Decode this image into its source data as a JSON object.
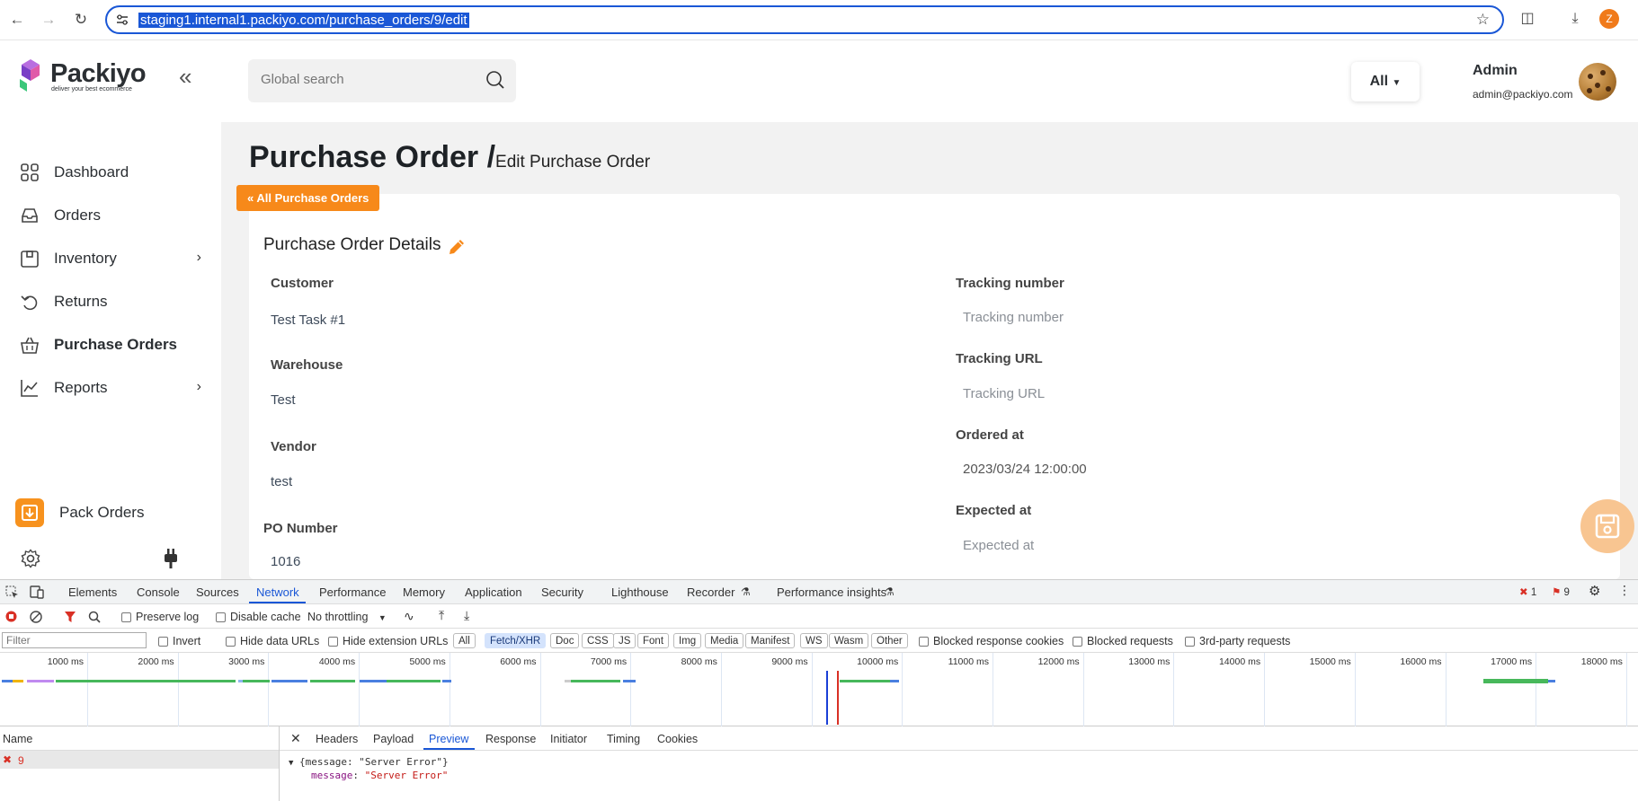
{
  "browser": {
    "url": "staging1.internal1.packiyo.com/purchase_orders/9/edit",
    "profile_initial": "Z"
  },
  "brand": {
    "name": "Packiyo",
    "tagline": "deliver your best ecommerce",
    "accent": "#f7891a"
  },
  "header": {
    "search_placeholder": "Global search",
    "scope_label": "All",
    "user_name": "Admin",
    "user_email": "admin@packiyo.com"
  },
  "sidebar": {
    "items": [
      {
        "label": "Dashboard",
        "icon": "grid-icon"
      },
      {
        "label": "Orders",
        "icon": "inbox-icon"
      },
      {
        "label": "Inventory",
        "icon": "box-icon"
      },
      {
        "label": "Returns",
        "icon": "undo-icon"
      },
      {
        "label": "Purchase Orders",
        "icon": "basket-icon"
      },
      {
        "label": "Reports",
        "icon": "chart-line-icon"
      }
    ],
    "pack_orders_label": "Pack Orders"
  },
  "page": {
    "title": "Purchase Order /",
    "subtitle": "Edit Purchase Order",
    "back_button": "All Purchase Orders",
    "card_title": "Purchase Order Details"
  },
  "form": {
    "left": [
      {
        "label": "Customer",
        "value": "Test Task #1"
      },
      {
        "label": "Warehouse",
        "value": "Test"
      },
      {
        "label": "Vendor",
        "value": "test"
      },
      {
        "label": "PO Number",
        "value": "1016"
      }
    ],
    "right": [
      {
        "label": "Tracking number",
        "placeholder": "Tracking number"
      },
      {
        "label": "Tracking URL",
        "placeholder": "Tracking URL"
      },
      {
        "label": "Ordered at",
        "value": "2023/03/24 12:00:00"
      },
      {
        "label": "Expected at",
        "placeholder": "Expected at"
      }
    ]
  },
  "devtools": {
    "tabs": [
      "Elements",
      "Console",
      "Sources",
      "Network",
      "Performance",
      "Memory",
      "Application",
      "Security",
      "Lighthouse",
      "Recorder",
      "Performance insights"
    ],
    "active_tab": "Network",
    "error_count": "1",
    "warning_count": "9",
    "toolbar": {
      "preserve_log": "Preserve log",
      "disable_cache": "Disable cache",
      "throttling": "No throttling"
    },
    "filter": {
      "placeholder": "Filter",
      "invert": "Invert",
      "hide_data_urls": "Hide data URLs",
      "hide_extension_urls": "Hide extension URLs",
      "types": [
        "All",
        "Fetch/XHR",
        "Doc",
        "CSS",
        "JS",
        "Font",
        "Img",
        "Media",
        "Manifest",
        "WS",
        "Wasm",
        "Other"
      ],
      "selected_type": "Fetch/XHR",
      "blocked_cookies": "Blocked response cookies",
      "blocked_requests": "Blocked requests",
      "third_party": "3rd-party requests"
    },
    "timeline_ticks": [
      "1000 ms",
      "2000 ms",
      "3000 ms",
      "4000 ms",
      "5000 ms",
      "6000 ms",
      "7000 ms",
      "8000 ms",
      "9000 ms",
      "10000 ms",
      "11000 ms",
      "12000 ms",
      "13000 ms",
      "14000 ms",
      "15000 ms",
      "16000 ms",
      "17000 ms",
      "18000 ms"
    ],
    "request_list": {
      "header": "Name",
      "rows": [
        {
          "name": "9",
          "status": "error"
        }
      ]
    },
    "detail_tabs": [
      "Headers",
      "Payload",
      "Preview",
      "Response",
      "Initiator",
      "Timing",
      "Cookies"
    ],
    "active_detail_tab": "Preview",
    "preview": {
      "summary": "{message: \"Server Error\"}",
      "key": "message",
      "value": "\"Server Error\""
    }
  }
}
